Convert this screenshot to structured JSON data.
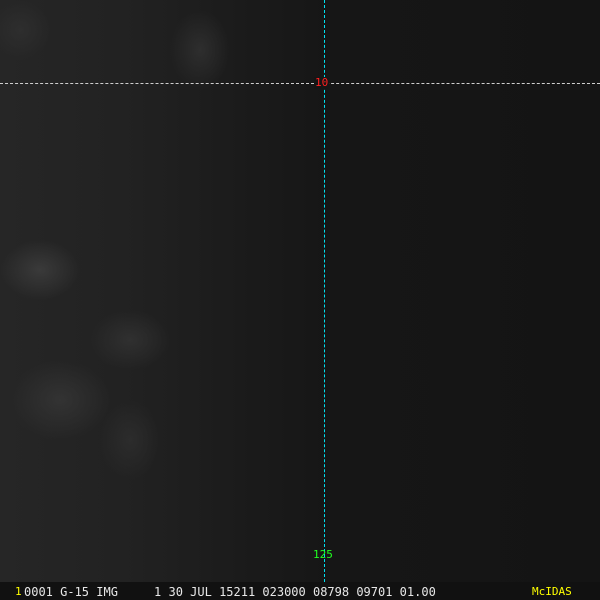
{
  "overlay": {
    "lat_label": "10",
    "lon_label": "125"
  },
  "status_bar": {
    "frame_number": "1",
    "image_info": "0001 G-15 IMG     1 30 JUL 15211 023000 08798 09701 01.00",
    "brand": "McIDAS"
  },
  "colors": {
    "lat_label": "#ff2020",
    "lon_label": "#20ff20",
    "grid_lon": "#00e0f0",
    "grid_lat": "#cfcfcf",
    "brand": "#ffff00"
  }
}
